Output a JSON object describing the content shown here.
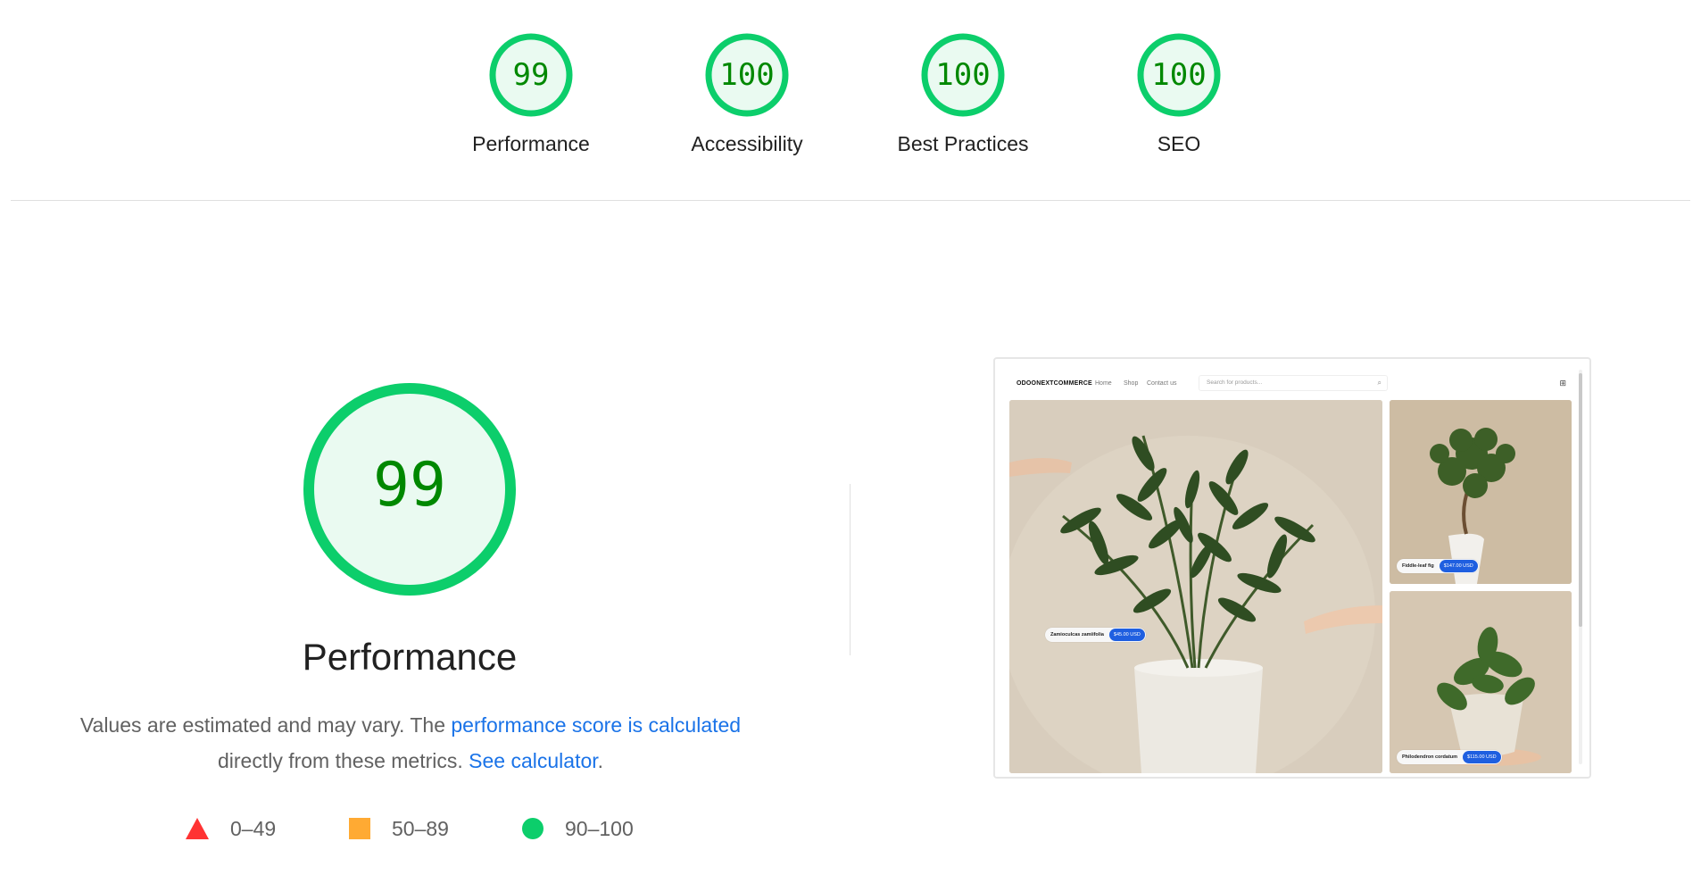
{
  "summary": {
    "gauges": [
      {
        "score": "99",
        "label": "Performance"
      },
      {
        "score": "100",
        "label": "Accessibility"
      },
      {
        "score": "100",
        "label": "Best Practices"
      },
      {
        "score": "100",
        "label": "SEO"
      }
    ]
  },
  "performance": {
    "score": "99",
    "title": "Performance",
    "desc_prefix": "Values are estimated and may vary. The ",
    "desc_link1": "performance score is calculated",
    "desc_middle": " directly from these metrics. ",
    "desc_link2": "See calculator",
    "desc_suffix": "."
  },
  "legend": {
    "fail": "0–49",
    "average": "50–89",
    "pass": "90–100"
  },
  "colors": {
    "pass": "#0cce6b",
    "pass_text": "#008800",
    "pass_bg": "#eafaf1",
    "average": "#ffaa33",
    "fail": "#ff3333",
    "link": "#1a73e8"
  },
  "thumbnail": {
    "brand": "ODOONEXTCOMMERCE",
    "nav": [
      "Home",
      "Shop",
      "Contact us"
    ],
    "search_placeholder": "Search for products...",
    "products": [
      {
        "name": "Zamioculcas zamiifolia",
        "price": "$45.00 USD"
      },
      {
        "name": "Fiddle-leaf fig",
        "price": "$147.00 USD"
      },
      {
        "name": "Philodendron cordatum",
        "price": "$115.00 USD"
      }
    ]
  }
}
